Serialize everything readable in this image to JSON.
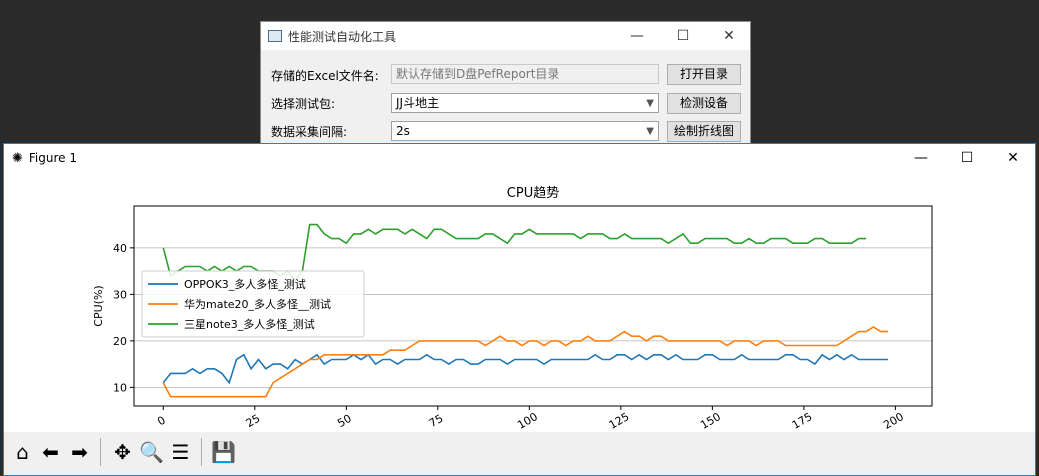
{
  "tool_window": {
    "title": "性能测试自动化工具",
    "minimize": "—",
    "maximize": "☐",
    "close": "✕",
    "excel_label": "存储的Excel文件名:",
    "excel_placeholder": "默认存储到D盘PefReport目录",
    "open_dir_button": "打开目录",
    "package_label": "选择测试包:",
    "package_value": "JJ斗地主",
    "detect_button": "检测设备",
    "interval_label": "数据采集间隔:",
    "interval_value": "2s",
    "draw_button": "绘制折线图"
  },
  "figure_window": {
    "title": "Figure 1",
    "minimize": "—",
    "maximize": "☐",
    "close": "✕",
    "toolbar": [
      "home-icon",
      "back-icon",
      "forward-icon",
      "pan-icon",
      "zoom-icon",
      "subplots-icon",
      "save-icon"
    ]
  },
  "colors": {
    "series1": "#1f77b4",
    "series2": "#ff7f0e",
    "series3": "#2ca02c"
  },
  "chart_data": {
    "type": "line",
    "title": "CPU趋势",
    "xlabel": "",
    "ylabel": "CPU(%)",
    "xlim": [
      -8,
      210
    ],
    "ylim": [
      6,
      49
    ],
    "xticks": [
      0,
      25,
      50,
      75,
      100,
      125,
      150,
      175,
      200
    ],
    "yticks": [
      10,
      20,
      30,
      40
    ],
    "grid": "horizontal",
    "legend": "center-left",
    "series": [
      {
        "name": "OPPOK3_多人多怪_测试",
        "x": [
          0,
          2,
          4,
          6,
          8,
          10,
          12,
          14,
          16,
          18,
          20,
          22,
          24,
          26,
          28,
          30,
          32,
          34,
          36,
          38,
          40,
          42,
          44,
          46,
          48,
          50,
          52,
          54,
          56,
          58,
          60,
          62,
          64,
          66,
          68,
          70,
          72,
          74,
          76,
          78,
          80,
          82,
          84,
          86,
          88,
          90,
          92,
          94,
          96,
          98,
          100,
          102,
          104,
          106,
          108,
          110,
          112,
          114,
          116,
          118,
          120,
          122,
          124,
          126,
          128,
          130,
          132,
          134,
          136,
          138,
          140,
          142,
          144,
          146,
          148,
          150,
          152,
          154,
          156,
          158,
          160,
          162,
          164,
          166,
          168,
          170,
          172,
          174,
          176,
          178,
          180,
          182,
          184,
          186,
          188,
          190,
          192,
          194,
          196,
          198
        ],
        "values": [
          11,
          13,
          13,
          13,
          14,
          13,
          14,
          14,
          13,
          11,
          16,
          17,
          14,
          16,
          14,
          15,
          15,
          14,
          16,
          15,
          16,
          17,
          15,
          16,
          16,
          16,
          17,
          16,
          17,
          15,
          16,
          16,
          15,
          16,
          16,
          16,
          17,
          16,
          16,
          15,
          16,
          16,
          15,
          15,
          16,
          16,
          16,
          15,
          16,
          16,
          16,
          16,
          15,
          16,
          16,
          16,
          16,
          16,
          16,
          17,
          16,
          16,
          17,
          17,
          16,
          17,
          16,
          17,
          17,
          16,
          17,
          16,
          16,
          16,
          17,
          17,
          16,
          16,
          16,
          17,
          16,
          16,
          16,
          16,
          16,
          17,
          17,
          16,
          16,
          15,
          17,
          16,
          17,
          16,
          17,
          16,
          16,
          16,
          16,
          16
        ]
      },
      {
        "name": "华为mate20_多人多怪__测试",
        "x": [
          0,
          2,
          4,
          6,
          8,
          10,
          12,
          14,
          16,
          18,
          20,
          22,
          24,
          26,
          28,
          30,
          32,
          34,
          36,
          38,
          40,
          42,
          44,
          46,
          48,
          50,
          52,
          54,
          56,
          58,
          60,
          62,
          64,
          66,
          68,
          70,
          72,
          74,
          76,
          78,
          80,
          82,
          84,
          86,
          88,
          90,
          92,
          94,
          96,
          98,
          100,
          102,
          104,
          106,
          108,
          110,
          112,
          114,
          116,
          118,
          120,
          122,
          124,
          126,
          128,
          130,
          132,
          134,
          136,
          138,
          140,
          142,
          144,
          146,
          148,
          150,
          152,
          154,
          156,
          158,
          160,
          162,
          164,
          166,
          168,
          170,
          172,
          174,
          176,
          178,
          180,
          182,
          184,
          186,
          188,
          190,
          192,
          194,
          196,
          198
        ],
        "values": [
          11,
          8,
          8,
          8,
          8,
          8,
          8,
          8,
          8,
          8,
          8,
          8,
          8,
          8,
          8,
          11,
          12,
          13,
          14,
          15,
          16,
          16,
          17,
          17,
          17,
          17,
          17,
          17,
          17,
          17,
          17,
          18,
          18,
          18,
          19,
          20,
          20,
          20,
          20,
          20,
          20,
          20,
          20,
          20,
          19,
          20,
          21,
          20,
          20,
          19,
          20,
          20,
          19,
          20,
          20,
          19,
          20,
          20,
          21,
          20,
          20,
          20,
          21,
          22,
          21,
          21,
          20,
          21,
          21,
          20,
          20,
          20,
          20,
          20,
          20,
          20,
          20,
          19,
          20,
          20,
          20,
          19,
          20,
          20,
          20,
          19,
          19,
          19,
          19,
          19,
          19,
          19,
          19,
          20,
          21,
          22,
          22,
          23,
          22,
          22
        ]
      },
      {
        "name": "三星note3_多人多怪_测试",
        "x": [
          0,
          2,
          4,
          6,
          8,
          10,
          12,
          14,
          16,
          18,
          20,
          22,
          24,
          26,
          28,
          30,
          32,
          34,
          36,
          38,
          40,
          42,
          44,
          46,
          48,
          50,
          52,
          54,
          56,
          58,
          60,
          62,
          64,
          66,
          68,
          70,
          72,
          74,
          76,
          78,
          80,
          82,
          84,
          86,
          88,
          90,
          92,
          94,
          96,
          98,
          100,
          102,
          104,
          106,
          108,
          110,
          112,
          114,
          116,
          118,
          120,
          122,
          124,
          126,
          128,
          130,
          132,
          134,
          136,
          138,
          140,
          142,
          144,
          146,
          148,
          150,
          152,
          154,
          156,
          158,
          160,
          162,
          164,
          166,
          168,
          170,
          172,
          174,
          176,
          178,
          180,
          182,
          184,
          186,
          188,
          190,
          192
        ],
        "values": [
          40,
          34,
          35,
          36,
          36,
          36,
          35,
          36,
          35,
          36,
          35,
          36,
          36,
          35,
          35,
          35,
          34,
          35,
          33,
          35,
          45,
          45,
          43,
          42,
          42,
          41,
          43,
          43,
          44,
          43,
          44,
          44,
          44,
          43,
          44,
          43,
          42,
          44,
          44,
          43,
          42,
          42,
          42,
          42,
          43,
          43,
          42,
          41,
          43,
          43,
          44,
          43,
          43,
          43,
          43,
          43,
          43,
          42,
          43,
          43,
          43,
          42,
          42,
          43,
          42,
          42,
          42,
          42,
          42,
          41,
          42,
          43,
          41,
          41,
          42,
          42,
          42,
          42,
          41,
          41,
          42,
          41,
          41,
          42,
          42,
          42,
          41,
          41,
          41,
          42,
          42,
          41,
          41,
          41,
          41,
          42,
          42
        ]
      }
    ]
  }
}
